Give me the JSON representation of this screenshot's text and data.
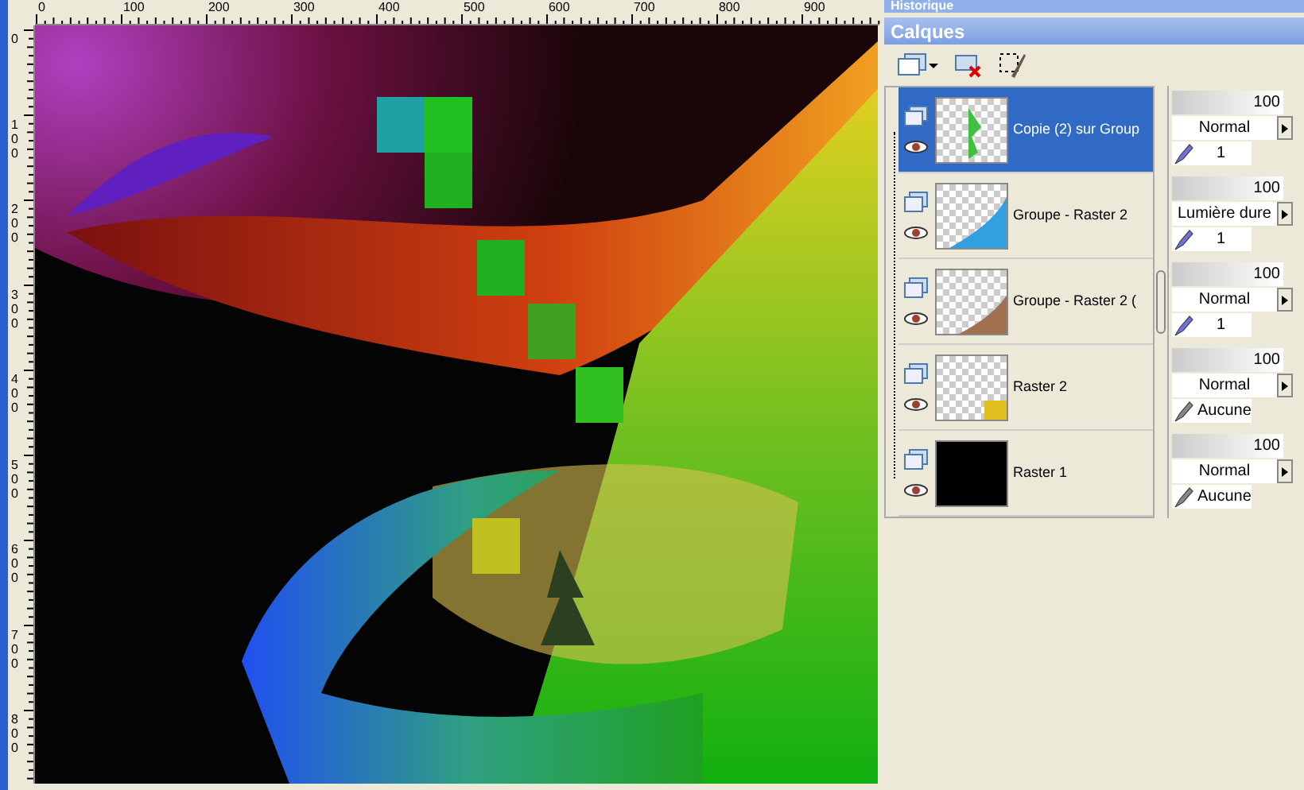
{
  "ruler_top": {
    "labels": [
      "0",
      "100",
      "200",
      "300",
      "400",
      "500",
      "600",
      "700",
      "800",
      "900"
    ]
  },
  "ruler_left": {
    "labels": [
      "0",
      "100",
      "200",
      "300",
      "400",
      "500",
      "600",
      "700",
      "800"
    ]
  },
  "history_panel": {
    "title": "Historique"
  },
  "layers_panel": {
    "title": "Calques",
    "layers": [
      {
        "name": "Copie (2) sur Group",
        "selected": true,
        "kind": "art",
        "opacity": "100",
        "blend_mode": "Normal",
        "link": {
          "kind": "group",
          "text": "1"
        }
      },
      {
        "name": "Groupe - Raster 2",
        "selected": false,
        "kind": "art",
        "opacity": "100",
        "blend_mode": "Lumière dure",
        "link": {
          "kind": "group",
          "text": "1"
        }
      },
      {
        "name": "Groupe - Raster 2 (",
        "selected": false,
        "kind": "art",
        "opacity": "100",
        "blend_mode": "Normal",
        "link": {
          "kind": "group",
          "text": "1"
        }
      },
      {
        "name": "Raster 2",
        "selected": false,
        "kind": "art",
        "opacity": "100",
        "blend_mode": "Normal",
        "link": {
          "kind": "none",
          "text": "Aucune"
        }
      },
      {
        "name": "Raster 1",
        "selected": false,
        "kind": "black",
        "opacity": "100",
        "blend_mode": "Normal",
        "link": {
          "kind": "none",
          "text": "Aucune"
        }
      }
    ]
  }
}
